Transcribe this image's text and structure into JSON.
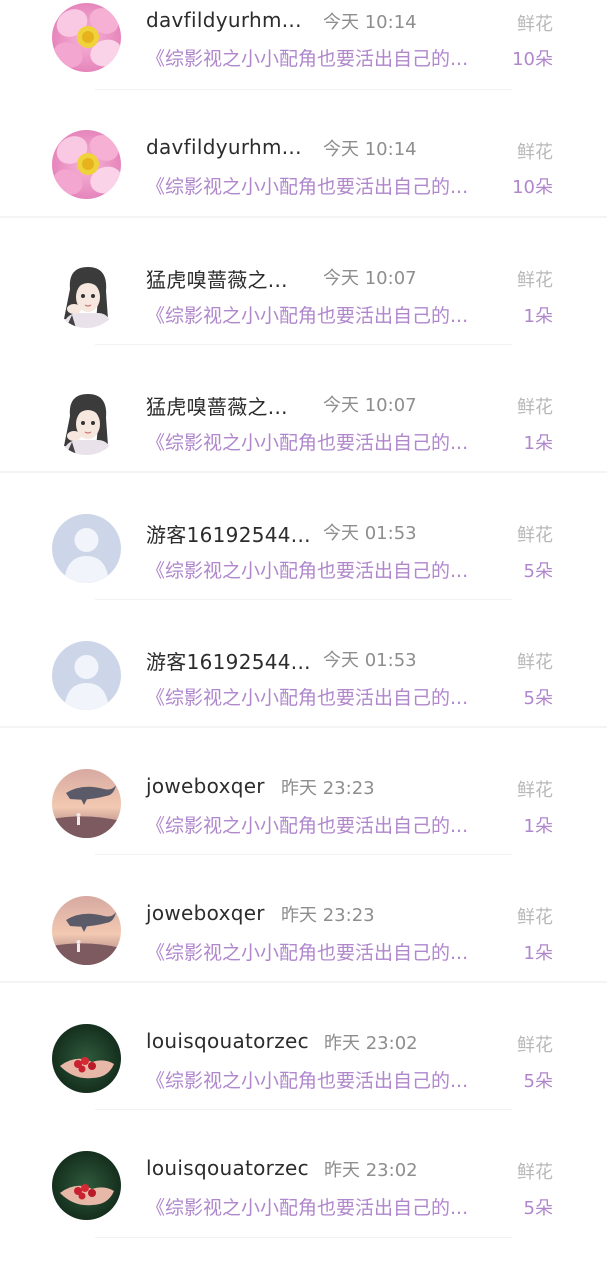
{
  "rows": [
    {
      "name": "davfildyurhm...",
      "time": "今天 10:14",
      "gift_type": "鲜花",
      "book": "《综影视之小小配角也要活出自己的...",
      "quantity": "10朵",
      "avatar": "lotus-avatar"
    },
    {
      "name": "davfildyurhm...",
      "time": "今天 10:14",
      "gift_type": "鲜花",
      "book": "《综影视之小小配角也要活出自己的...",
      "quantity": "10朵",
      "avatar": "lotus-avatar"
    },
    {
      "name": "猛虎嗅蔷薇之...",
      "time": "今天 10:07",
      "gift_type": "鲜花",
      "book": "《综影视之小小配角也要活出自己的...",
      "quantity": "1朵",
      "avatar": "anime-girl-avatar"
    },
    {
      "name": "猛虎嗅蔷薇之...",
      "time": "今天 10:07",
      "gift_type": "鲜花",
      "book": "《综影视之小小配角也要活出自己的...",
      "quantity": "1朵",
      "avatar": "anime-girl-avatar"
    },
    {
      "name": "游客16192544...",
      "time": "今天 01:53",
      "gift_type": "鲜花",
      "book": "《综影视之小小配角也要活出自己的...",
      "quantity": "5朵",
      "avatar": "default-user-avatar"
    },
    {
      "name": "游客16192544...",
      "time": "今天 01:53",
      "gift_type": "鲜花",
      "book": "《综影视之小小配角也要活出自己的...",
      "quantity": "5朵",
      "avatar": "default-user-avatar"
    },
    {
      "name": "joweboxqer",
      "time": "昨天 23:23",
      "gift_type": "鲜花",
      "book": "《综影视之小小配角也要活出自己的...",
      "quantity": "1朵",
      "avatar": "whale-sky-avatar"
    },
    {
      "name": "joweboxqer",
      "time": "昨天 23:23",
      "gift_type": "鲜花",
      "book": "《综影视之小小配角也要活出自己的...",
      "quantity": "1朵",
      "avatar": "whale-sky-avatar"
    },
    {
      "name": "louisqouatorzec",
      "time": "昨天 23:02",
      "gift_type": "鲜花",
      "book": "《综影视之小小配角也要活出自己的...",
      "quantity": "5朵",
      "avatar": "strawberry-hands-avatar"
    },
    {
      "name": "louisqouatorzec",
      "time": "昨天 23:02",
      "gift_type": "鲜花",
      "book": "《综影视之小小配角也要活出自己的...",
      "quantity": "5朵",
      "avatar": "strawberry-hands-avatar"
    }
  ]
}
